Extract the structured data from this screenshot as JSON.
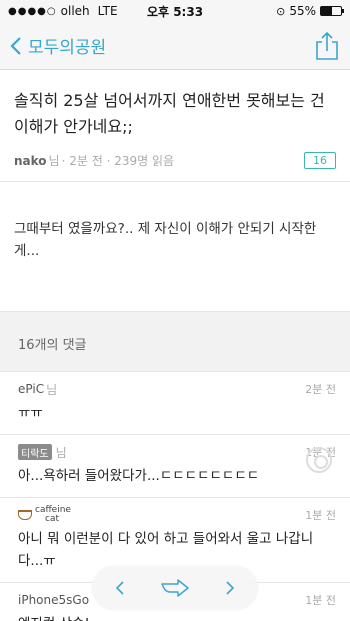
{
  "status_bar": {
    "carrier": "olleh",
    "network": "LTE",
    "time": "오후 5:33",
    "battery": "55%",
    "battery_level": 0.55
  },
  "nav": {
    "back_label": "모두의공원"
  },
  "post": {
    "title": "솔직히 25살 넘어서까지 연애한번 못해보는 건 이해가 안가네요;;",
    "author": "nako",
    "author_suffix": "님",
    "meta": "· 2분 전 · 239명 읽음",
    "comment_count": "16",
    "body": "그때부터 였을까요?.. 제 자신이 이해가 안되기 시작한게..."
  },
  "comments_header": "16개의 댓글",
  "comments": [
    {
      "author": "ePiC",
      "suffix": "님",
      "time": "2분 전",
      "text": "ㅠㅠ"
    },
    {
      "author": "",
      "avatar": "티락도",
      "suffix": "님",
      "time": "1분 전",
      "text": "아...욕하러 들어왔다가...ㄷㄷㄷㄷㄷㄷㄷㄷ"
    },
    {
      "author": "",
      "avatar_line1": "caffeine",
      "avatar_line2": "cat",
      "suffix": "",
      "time": "1분 전",
      "text": "아니 뭐 이런분이 다 있어 하고 들어와서 울고 나갑니다...ㅠ"
    },
    {
      "author": "iPhone5sGo",
      "suffix": "",
      "time": "1분 전",
      "text": "엔지컴 상승!"
    }
  ],
  "icons": {
    "back": "chevron-left-icon",
    "share": "share-icon",
    "prev": "chevron-left-icon",
    "reply": "reply-arrow-icon",
    "next": "chevron-right-icon"
  },
  "colors": {
    "accent": "#3aa6cf",
    "badge": "#3ab6b0"
  }
}
